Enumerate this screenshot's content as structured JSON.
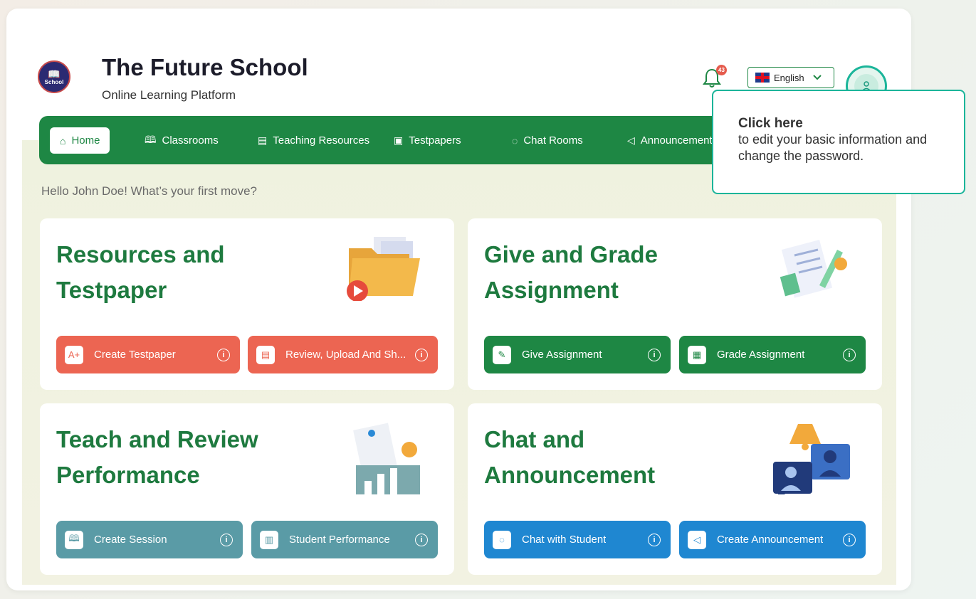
{
  "header": {
    "logo_text": "School",
    "title": "The Future School",
    "subtitle": "Online Learning Platform",
    "notification_count": "43",
    "language": "English"
  },
  "nav": {
    "items": [
      {
        "label": "Home",
        "icon": "home-icon"
      },
      {
        "label": "Classrooms",
        "icon": "book-open-icon"
      },
      {
        "label": "Teaching Resources",
        "icon": "bookmark-icon"
      },
      {
        "label": "Testpapers",
        "icon": "grade-icon"
      },
      {
        "label": "Chat Rooms",
        "icon": "chat-bubble-icon"
      },
      {
        "label": "Announcement",
        "icon": "megaphone-icon"
      }
    ]
  },
  "greeting": "Hello John Doe! What’s your first move?",
  "tooltip": {
    "title": "Click here",
    "text": "to edit your basic information and change the password."
  },
  "cards": [
    {
      "title": "Resources and Testpaper",
      "buttons": [
        {
          "label": "Create Testpaper",
          "icon": "testpaper-icon"
        },
        {
          "label": "Review, Upload And Sh...",
          "icon": "resource-icon"
        }
      ]
    },
    {
      "title": "Give and Grade Assignment",
      "buttons": [
        {
          "label": "Give Assignment",
          "icon": "pen-icon"
        },
        {
          "label": "Grade Assignment",
          "icon": "grade-sheet-icon"
        }
      ]
    },
    {
      "title": "Teach and Review Performance",
      "buttons": [
        {
          "label": "Create Session",
          "icon": "book-icon"
        },
        {
          "label": "Student Performance",
          "icon": "chart-icon"
        }
      ]
    },
    {
      "title": "Chat and Announcement",
      "buttons": [
        {
          "label": "Chat with Student",
          "icon": "chat-icon"
        },
        {
          "label": "Create Announcement",
          "icon": "megaphone-icon"
        }
      ]
    }
  ],
  "colors": {
    "primary_green": "#1e8744",
    "accent_teal": "#1bb59a",
    "red": "#ec6552",
    "teal_btn": "#5a9ba6",
    "blue": "#1f87d1"
  }
}
